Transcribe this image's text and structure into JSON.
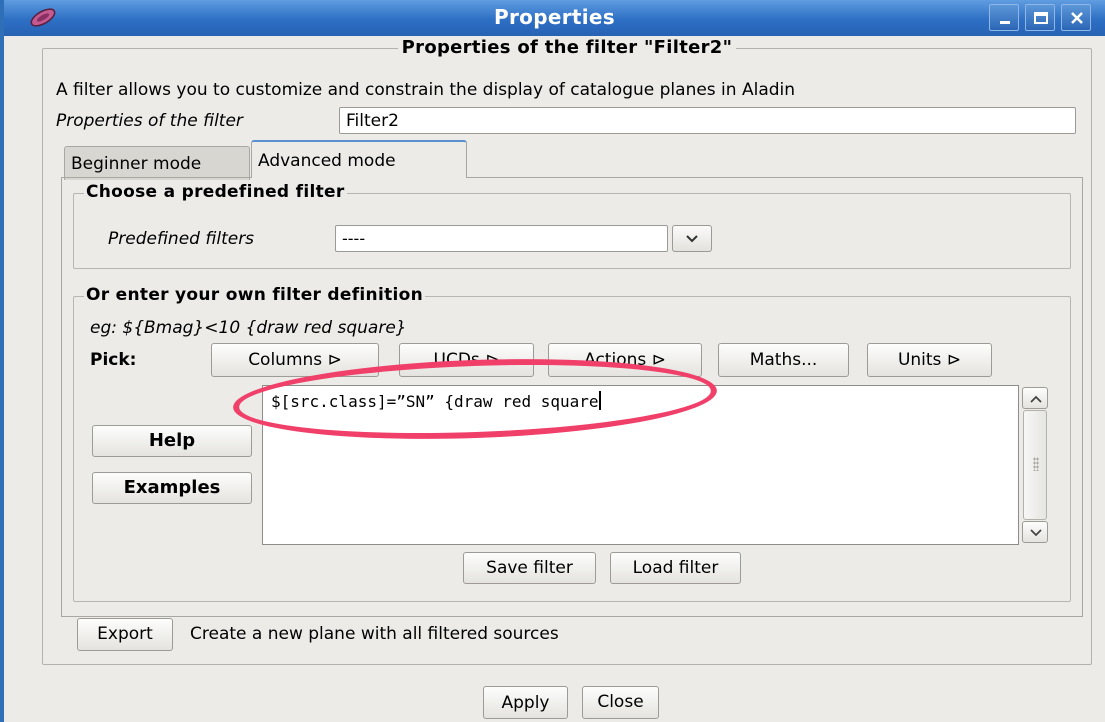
{
  "window": {
    "title": "Properties",
    "accent_color": "#2d6fc4",
    "icons": [
      "app-icon",
      "minimize-icon",
      "maximize-icon",
      "close-icon"
    ]
  },
  "header": {
    "title": "Properties of the filter \"Filter2\""
  },
  "description": "A filter allows you to customize and constrain the display of catalogue planes in Aladin",
  "properties": {
    "label": "Properties of the filter",
    "value": "Filter2"
  },
  "tabs": [
    {
      "label": "Beginner mode",
      "active": false
    },
    {
      "label": "Advanced mode",
      "active": true
    }
  ],
  "predefined": {
    "group_title": "Choose a predefined filter",
    "label": "Predefined filters",
    "selected": "----"
  },
  "own_filter": {
    "group_title": "Or enter your own filter definition",
    "example": "eg: ${Bmag}<10 {draw red square}",
    "pick_label": "Pick:",
    "pick_buttons": [
      "Columns ⊳",
      "UCDs ⊳",
      "Actions ⊳",
      "Maths...",
      "Units ⊳"
    ],
    "help_label": "Help",
    "examples_label": "Examples",
    "editor_text": "$[src.class]=”SN” {draw red square",
    "save_label": "Save filter",
    "load_label": "Load filter"
  },
  "export": {
    "button_label": "Export",
    "text": "Create a new plane with all filtered sources"
  },
  "footer": {
    "apply_label": "Apply",
    "close_label": "Close"
  },
  "annotation": {
    "highlight_color": "#f0406a"
  }
}
